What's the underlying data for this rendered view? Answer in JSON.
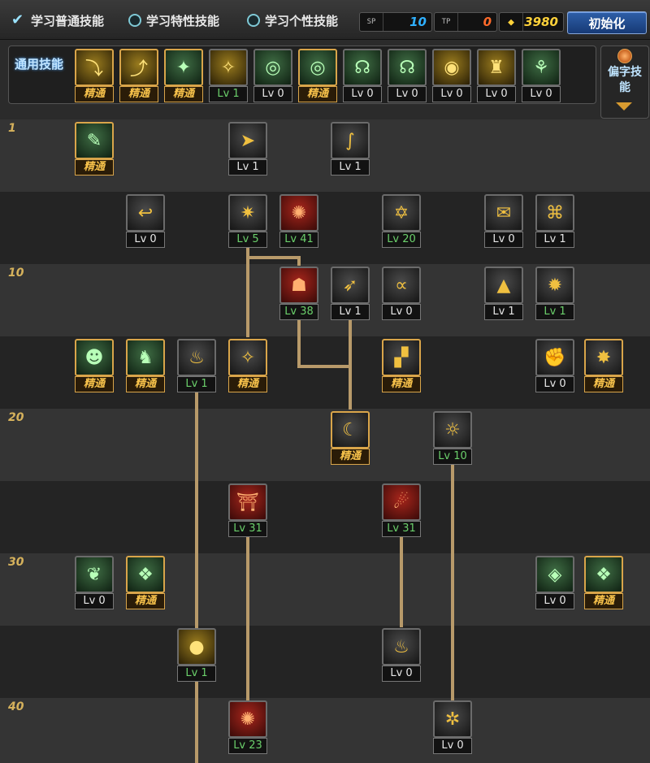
{
  "tabs": [
    {
      "label": "学习普通技能",
      "selected": true
    },
    {
      "label": "学习特性技能",
      "selected": false
    },
    {
      "label": "学习个性技能",
      "selected": false
    }
  ],
  "counters": [
    {
      "icon": "SP",
      "icon_name": "sp-icon",
      "value": "10",
      "color": "#2fb0ff"
    },
    {
      "icon": "TP",
      "icon_name": "tp-icon",
      "value": "0",
      "color": "#ff6a2a"
    },
    {
      "icon": "◆",
      "icon_name": "gold-icon",
      "value": "3980",
      "color": "#ffd23a"
    }
  ],
  "init_button": "初始化",
  "common_label": "通用技能",
  "side_label": "偏字技能",
  "level_labels": [
    "1",
    "10",
    "20",
    "30",
    "40"
  ],
  "colors": {
    "master_border": "#d9a54a",
    "level_green": "#6bd06b",
    "line": "#b89a6a"
  },
  "common_skills": [
    {
      "icon_name": "crouch-skill-icon",
      "glyph": "⤵",
      "badge": "精通",
      "master": true,
      "green": false,
      "tint": "yellow"
    },
    {
      "icon_name": "rise-skill-icon",
      "glyph": "⤴",
      "badge": "精通",
      "master": true,
      "green": false,
      "tint": "yellow"
    },
    {
      "icon_name": "kick-skill-icon",
      "glyph": "✦",
      "badge": "精通",
      "master": true,
      "green": false,
      "tint": "green"
    },
    {
      "icon_name": "wings-skill-icon",
      "glyph": "✧",
      "badge": "Lv 1",
      "master": false,
      "green": true,
      "tint": "yellow"
    },
    {
      "icon_name": "target-skill-icon",
      "glyph": "◎",
      "badge": "Lv 0",
      "master": false,
      "green": false,
      "tint": "green"
    },
    {
      "icon_name": "target2-skill-icon",
      "glyph": "◎",
      "badge": "精通",
      "master": true,
      "green": false,
      "tint": "green"
    },
    {
      "icon_name": "shout-skill-icon",
      "glyph": "☊",
      "badge": "Lv 0",
      "master": false,
      "green": false,
      "tint": "green"
    },
    {
      "icon_name": "shout2-skill-icon",
      "glyph": "☊",
      "badge": "Lv 0",
      "master": false,
      "green": false,
      "tint": "green"
    },
    {
      "icon_name": "eye-skill-icon",
      "glyph": "◉",
      "badge": "Lv 0",
      "master": false,
      "green": false,
      "tint": "yellow"
    },
    {
      "icon_name": "strength-skill-icon",
      "glyph": "♜",
      "badge": "Lv 0",
      "master": false,
      "green": false,
      "tint": "yellow"
    },
    {
      "icon_name": "walk-skill-icon",
      "glyph": "⚘",
      "badge": "Lv 0",
      "master": false,
      "green": false,
      "tint": "green"
    }
  ],
  "tree_skills": [
    {
      "icon_name": "scroll-skill-icon",
      "glyph": "✎",
      "badge": "精通",
      "master": true,
      "green": false,
      "tint": "green"
    },
    {
      "icon_name": "dash-skill-icon",
      "glyph": "➤",
      "badge": "Lv 1",
      "master": false,
      "green": false,
      "tint": ""
    },
    {
      "icon_name": "hook-skill-icon",
      "glyph": "∫",
      "badge": "Lv 1",
      "master": false,
      "green": false,
      "tint": ""
    },
    {
      "icon_name": "whip-skill-icon",
      "glyph": "↩",
      "badge": "Lv 0",
      "master": false,
      "green": false,
      "tint": ""
    },
    {
      "icon_name": "beetle-skill-icon",
      "glyph": "✷",
      "badge": "Lv 5",
      "master": false,
      "green": true,
      "tint": ""
    },
    {
      "icon_name": "vortex-skill-icon",
      "glyph": "✺",
      "badge": "Lv 41",
      "master": false,
      "green": true,
      "tint": "red"
    },
    {
      "icon_name": "rune-skill-icon",
      "glyph": "✡",
      "badge": "Lv 20",
      "master": false,
      "green": true,
      "tint": ""
    },
    {
      "icon_name": "book-skill-icon",
      "glyph": "✉",
      "badge": "Lv 0",
      "master": false,
      "green": false,
      "tint": ""
    },
    {
      "icon_name": "weave-skill-icon",
      "glyph": "⌘",
      "badge": "Lv 1",
      "master": false,
      "green": false,
      "tint": ""
    },
    {
      "icon_name": "witch-skill-icon",
      "glyph": "☗",
      "badge": "Lv 38",
      "master": false,
      "green": true,
      "tint": "red"
    },
    {
      "icon_name": "strike-skill-icon",
      "glyph": "➶",
      "badge": "Lv 1",
      "master": false,
      "green": false,
      "tint": ""
    },
    {
      "icon_name": "loop-skill-icon",
      "glyph": "∝",
      "badge": "Lv 0",
      "master": false,
      "green": false,
      "tint": ""
    },
    {
      "icon_name": "hat-skill-icon",
      "glyph": "▲",
      "badge": "Lv 1",
      "master": false,
      "green": false,
      "tint": ""
    },
    {
      "icon_name": "burst-skill-icon",
      "glyph": "✹",
      "badge": "Lv 1",
      "master": false,
      "green": true,
      "tint": ""
    },
    {
      "icon_name": "head-skill-icon",
      "glyph": "☻",
      "badge": "精通",
      "master": true,
      "green": false,
      "tint": "green"
    },
    {
      "icon_name": "runner-skill-icon",
      "glyph": "♞",
      "badge": "精通",
      "master": true,
      "green": false,
      "tint": "green"
    },
    {
      "icon_name": "flame-pillar-skill-icon",
      "glyph": "♨",
      "badge": "Lv 1",
      "master": false,
      "green": true,
      "tint": ""
    },
    {
      "icon_name": "spark-skill-icon",
      "glyph": "✧",
      "badge": "精通",
      "master": true,
      "green": false,
      "tint": ""
    },
    {
      "icon_name": "door-skill-icon",
      "glyph": "▞",
      "badge": "精通",
      "master": true,
      "green": false,
      "tint": ""
    },
    {
      "icon_name": "fist-skill-icon",
      "glyph": "✊",
      "badge": "Lv 0",
      "master": false,
      "green": false,
      "tint": ""
    },
    {
      "icon_name": "explosion-skill-icon",
      "glyph": "✸",
      "badge": "精通",
      "master": true,
      "green": false,
      "tint": ""
    },
    {
      "icon_name": "moon-star-skill-icon",
      "glyph": "☾",
      "badge": "精通",
      "master": true,
      "green": false,
      "tint": ""
    },
    {
      "icon_name": "sun-skill-icon",
      "glyph": "☼",
      "badge": "Lv 10",
      "master": false,
      "green": true,
      "tint": ""
    },
    {
      "icon_name": "gate-skill-icon",
      "glyph": "⛩",
      "badge": "Lv 31",
      "master": false,
      "green": true,
      "tint": "red"
    },
    {
      "icon_name": "meteor-skill-icon",
      "glyph": "☄",
      "badge": "Lv 31",
      "master": false,
      "green": true,
      "tint": "red"
    },
    {
      "icon_name": "leaf-skill-icon",
      "glyph": "❦",
      "badge": "Lv 0",
      "master": false,
      "green": false,
      "tint": "green"
    },
    {
      "icon_name": "crystal-skill-icon",
      "glyph": "❖",
      "badge": "精通",
      "master": true,
      "green": false,
      "tint": "green"
    },
    {
      "icon_name": "diamond-skill-icon",
      "glyph": "◈",
      "badge": "Lv 0",
      "master": false,
      "green": false,
      "tint": "green"
    },
    {
      "icon_name": "crystal2-skill-icon",
      "glyph": "❖",
      "badge": "精通",
      "master": true,
      "green": false,
      "tint": "green"
    },
    {
      "icon_name": "fireball-skill-icon",
      "glyph": "●",
      "badge": "Lv 1",
      "master": false,
      "green": true,
      "tint": "yellow"
    },
    {
      "icon_name": "fire-skill-icon",
      "glyph": "♨",
      "badge": "Lv 0",
      "master": false,
      "green": false,
      "tint": ""
    },
    {
      "icon_name": "inferno-skill-icon",
      "glyph": "✺",
      "badge": "Lv 23",
      "master": false,
      "green": true,
      "tint": "red"
    },
    {
      "icon_name": "swirl-skill-icon",
      "glyph": "✲",
      "badge": "Lv 0",
      "master": false,
      "green": false,
      "tint": ""
    }
  ]
}
